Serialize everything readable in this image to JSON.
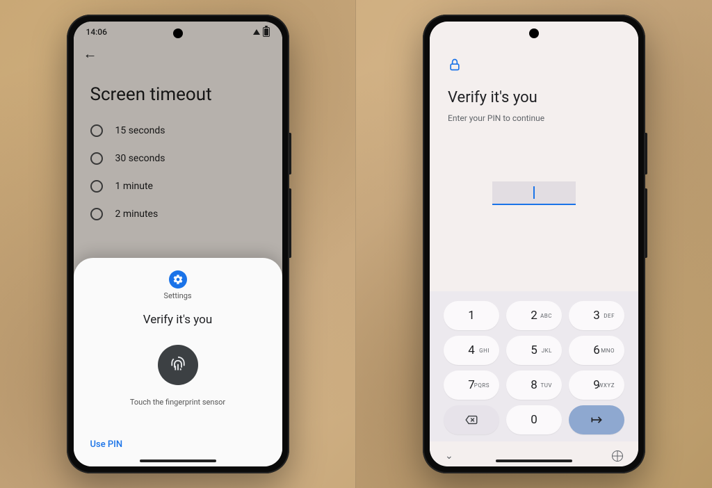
{
  "left": {
    "status_time": "14:06",
    "page_title": "Screen timeout",
    "options": [
      {
        "label": "15 seconds"
      },
      {
        "label": "30 seconds"
      },
      {
        "label": "1 minute"
      },
      {
        "label": "2 minutes"
      }
    ],
    "sheet": {
      "app_label": "Settings",
      "title": "Verify it's you",
      "hint": "Touch the fingerprint sensor",
      "alt_action": "Use PIN"
    }
  },
  "right": {
    "title": "Verify it's you",
    "subtitle": "Enter your PIN to continue",
    "keys": [
      {
        "n": "1",
        "l": ""
      },
      {
        "n": "2",
        "l": "ABC"
      },
      {
        "n": "3",
        "l": "DEF"
      },
      {
        "n": "4",
        "l": "GHI"
      },
      {
        "n": "5",
        "l": "JKL"
      },
      {
        "n": "6",
        "l": "MNO"
      },
      {
        "n": "7",
        "l": "PQRS"
      },
      {
        "n": "8",
        "l": "TUV"
      },
      {
        "n": "9",
        "l": "WXYZ"
      }
    ],
    "key_zero": "0",
    "nav_collapse": "⌄"
  }
}
